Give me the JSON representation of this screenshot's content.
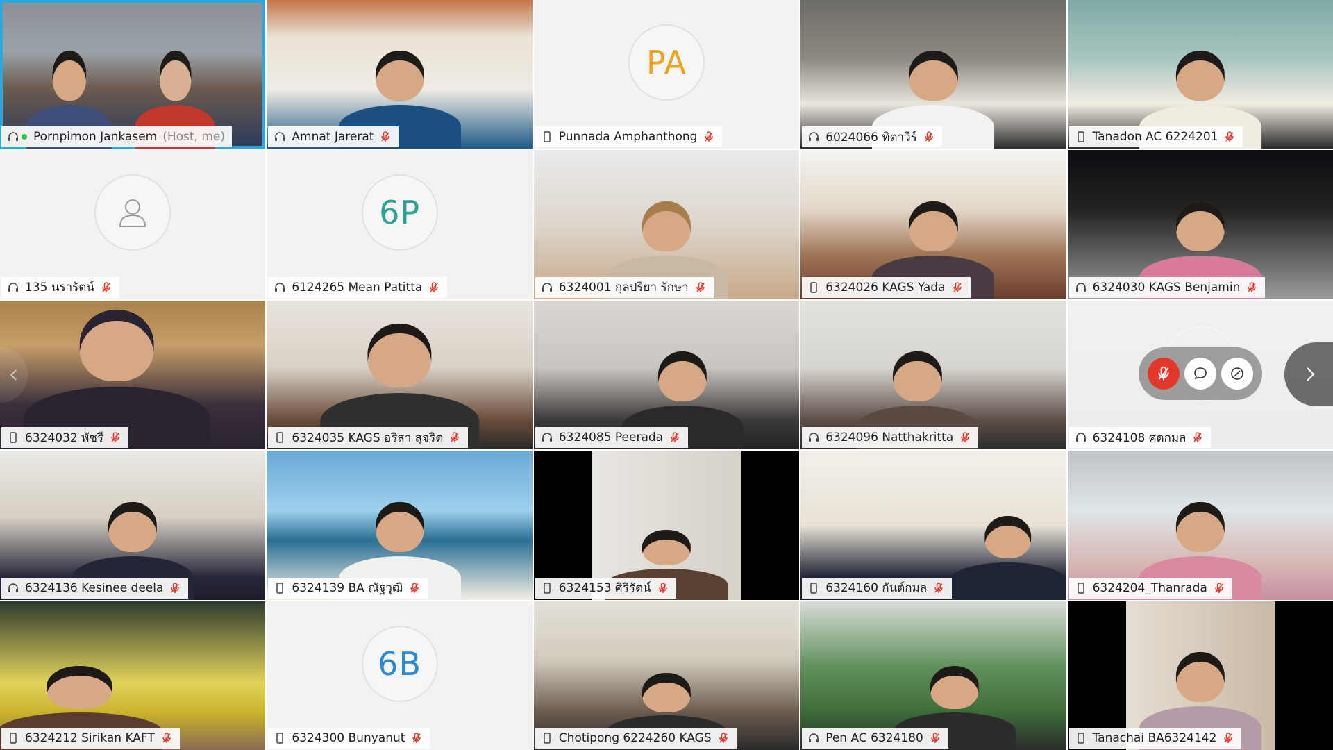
{
  "app": {
    "accent": "#2aa6e0",
    "mic_off_color": "#e5362b"
  },
  "participants": [
    {
      "name": "Pornpimon Jankasem",
      "sub": "(Host, me)",
      "icon": "headset-icon",
      "mic": "active"
    },
    {
      "name": "Amnat Jarerat",
      "icon": "headset-icon",
      "mic": "muted"
    },
    {
      "name": "Punnada Amphanthong",
      "icon": "phone-icon",
      "mic": "muted",
      "initials": "PA",
      "initials_color": "#f0a21c"
    },
    {
      "name": "6024066 ทิตาวีร์",
      "icon": "headset-icon",
      "mic": "muted"
    },
    {
      "name": "Tanadon AC 6224201",
      "icon": "phone-icon",
      "mic": "muted"
    },
    {
      "name": "135 นรารัตน์",
      "icon": "headset-icon",
      "mic": "muted",
      "avatar": "user-icon"
    },
    {
      "name": "6124265 Mean Patitta",
      "icon": "headset-icon",
      "mic": "muted",
      "initials": "6P",
      "initials_color": "#2aa395"
    },
    {
      "name": "6324001 กุลปริยา รักษา",
      "icon": "headset-icon",
      "mic": "muted"
    },
    {
      "name": "6324026 KAGS Yada",
      "icon": "phone-icon",
      "mic": "muted"
    },
    {
      "name": "6324030 KAGS Benjamin",
      "icon": "headset-icon",
      "mic": "muted"
    },
    {
      "name": "6324032 พัชรี",
      "icon": "phone-icon",
      "mic": "muted"
    },
    {
      "name": "6324035 KAGS อริสา สุจริต",
      "icon": "phone-icon",
      "mic": "muted"
    },
    {
      "name": "6324085 Peerada",
      "icon": "headset-icon",
      "mic": "muted"
    },
    {
      "name": "6324096 Natthakritta",
      "icon": "headset-icon",
      "mic": "muted"
    },
    {
      "name": "6324108 ศตกมล",
      "icon": "headset-icon",
      "mic": "muted"
    },
    {
      "name": "6324136 Kesinee deela",
      "icon": "headset-icon",
      "mic": "muted"
    },
    {
      "name": "6324139 BA ณัฐวุฒิ",
      "icon": "phone-icon",
      "mic": "muted"
    },
    {
      "name": "6324153 ศิริรัตน์",
      "icon": "phone-icon",
      "mic": "muted"
    },
    {
      "name": "6324160 กันต์กมล",
      "icon": "phone-icon",
      "mic": "muted"
    },
    {
      "name": "6324204_Thanrada",
      "icon": "phone-icon",
      "mic": "muted"
    },
    {
      "name": "6324212 Sirikan KAFT",
      "icon": "phone-icon",
      "mic": "muted"
    },
    {
      "name": "6324300 Bunyanut",
      "icon": "phone-icon",
      "mic": "muted",
      "initials": "6B",
      "initials_color": "#2a8ad6"
    },
    {
      "name": "Chotipong 6224260 KAGS",
      "icon": "phone-icon",
      "mic": "muted"
    },
    {
      "name": "Pen AC 6324180",
      "icon": "headset-icon",
      "mic": "muted"
    },
    {
      "name": "Tanachai BA6324142",
      "icon": "phone-icon",
      "mic": "muted"
    }
  ],
  "controls": {
    "mute_icon": "mic-off-icon",
    "chat_icon": "chat-icon",
    "more_icon": "more-icon",
    "next_icon": "chevron-right-icon",
    "prev_icon": "chevron-left-icon"
  }
}
